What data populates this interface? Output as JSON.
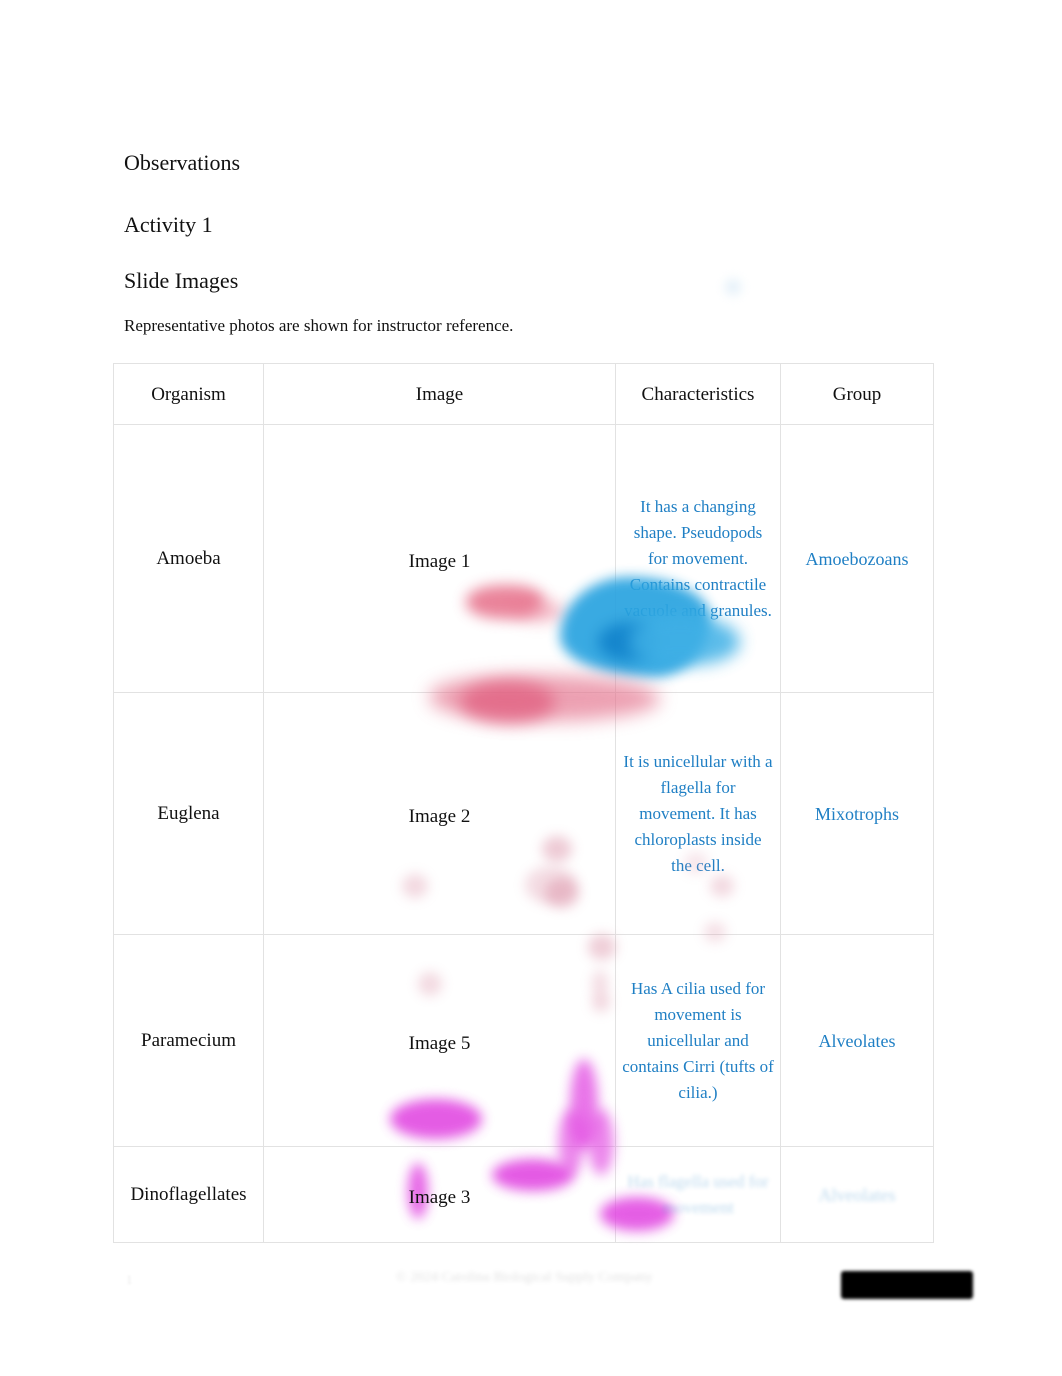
{
  "document": {
    "headings": {
      "observations": "Observations",
      "activity": "Activity 1",
      "slide_images": "Slide Images"
    },
    "note": "Representative photos are shown for instructor reference."
  },
  "table": {
    "headers": {
      "organism": "Organism",
      "image": "Image",
      "characteristics": "Characteristics",
      "group": "Group"
    },
    "rows": [
      {
        "organism": "Amoeba",
        "image_label": "Image 1",
        "characteristics": "It has a changing shape. Pseudopods for movement. Contains contractile vacuole and granules.",
        "group": "Amoebozoans",
        "faded": false
      },
      {
        "organism": "Euglena",
        "image_label": "Image 2",
        "characteristics": "It is unicellular with a flagella for movement. It has chloroplasts inside the cell.",
        "group": "Mixotrophs",
        "faded": false
      },
      {
        "organism": "Paramecium",
        "image_label": "Image 5",
        "characteristics": "Has A cilia used for movement is unicellular and contains Cirri (tufts of cilia.)",
        "group": "Alveolates",
        "faded": false
      },
      {
        "organism": "Dinoflagellates",
        "image_label": "Image 3",
        "characteristics": "Has flagella used for movement",
        "group": "Alveolates",
        "faded": true
      }
    ]
  },
  "footer": {
    "page_number": "1",
    "center_text": "© 2024 Carolina Biological Supply Company",
    "redaction": ""
  },
  "colors": {
    "heading_text": "#111111",
    "answer_blue": "#1f7fc4",
    "table_border": "#e2e2e2",
    "page_background": "#ffffff",
    "redaction_bar": "#000000"
  }
}
